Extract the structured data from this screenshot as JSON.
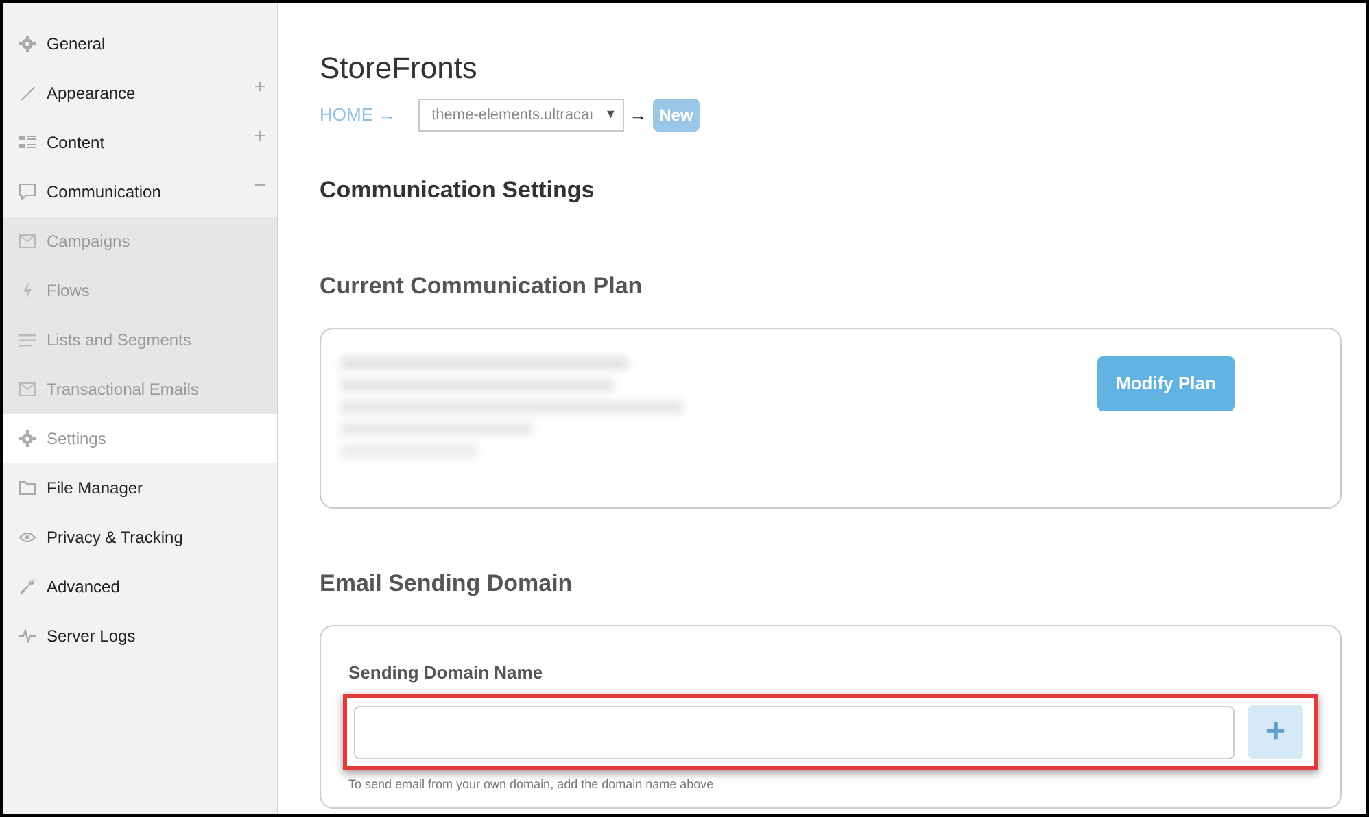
{
  "sidebar": {
    "items": [
      {
        "label": "General",
        "kind": "main",
        "selected": false
      },
      {
        "label": "Appearance",
        "kind": "main",
        "selected": false,
        "toggle": "+"
      },
      {
        "label": "Content",
        "kind": "main",
        "selected": false,
        "toggle": "+"
      },
      {
        "label": "Communication",
        "kind": "main",
        "selected": false,
        "toggle": "−"
      },
      {
        "label": "Campaigns",
        "kind": "sub",
        "selected": false
      },
      {
        "label": "Flows",
        "kind": "sub",
        "selected": false
      },
      {
        "label": "Lists and Segments",
        "kind": "sub",
        "selected": false
      },
      {
        "label": "Transactional Emails",
        "kind": "sub",
        "selected": false
      },
      {
        "label": "Settings",
        "kind": "sub",
        "selected": true
      },
      {
        "label": "File Manager",
        "kind": "main",
        "selected": false
      },
      {
        "label": "Privacy & Tracking",
        "kind": "main",
        "selected": false
      },
      {
        "label": "Advanced",
        "kind": "main",
        "selected": false
      },
      {
        "label": "Server Logs",
        "kind": "main",
        "selected": false
      }
    ]
  },
  "page_title": "StoreFronts",
  "breadcrumb": {
    "home": "HOME →",
    "store_select": "theme-elements.ultracaı",
    "caret": "▼",
    "arrow": "→",
    "badge": "New"
  },
  "heading": "Communication Settings",
  "plan": {
    "title": "Current Communication Plan",
    "button": "Modify Plan"
  },
  "domain": {
    "title": "Email Sending Domain",
    "label": "Sending Domain Name",
    "add_button": "+",
    "help": "To send email from your own domain, add the domain name above"
  }
}
